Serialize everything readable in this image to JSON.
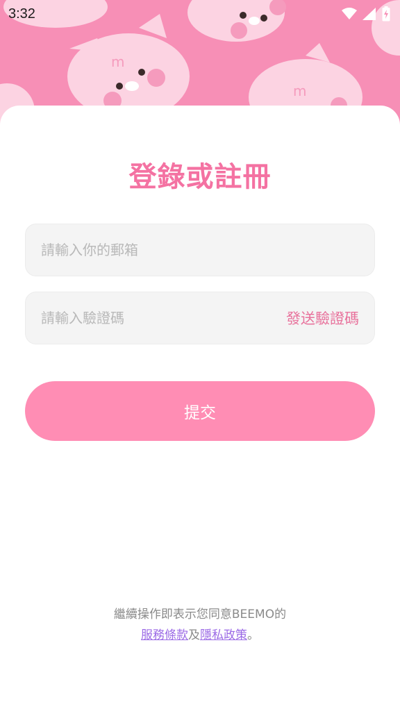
{
  "status_bar": {
    "time": "3:32",
    "icons": [
      "wifi-icon",
      "signal-icon",
      "battery-charging-icon"
    ]
  },
  "hero": {
    "background_color": "#f78fb6",
    "character_color": "#fcd3e2",
    "cheek_color": "#f59bbd"
  },
  "login": {
    "title": "登錄或註冊",
    "email_placeholder": "請輸入你的郵箱",
    "email_value": "",
    "code_placeholder": "請輸入驗證碼",
    "code_value": "",
    "send_code_label": "發送驗證碼",
    "submit_label": "提交"
  },
  "terms": {
    "prefix": "繼續操作即表示您同意BEEMO的",
    "service_link": "服務條款",
    "connector": "及",
    "privacy_link": "隱私政策",
    "suffix": "。"
  },
  "colors": {
    "accent": "#f472a2",
    "button": "#ff8db4",
    "link": "#9b6ae6",
    "input_bg": "#f4f4f4"
  }
}
